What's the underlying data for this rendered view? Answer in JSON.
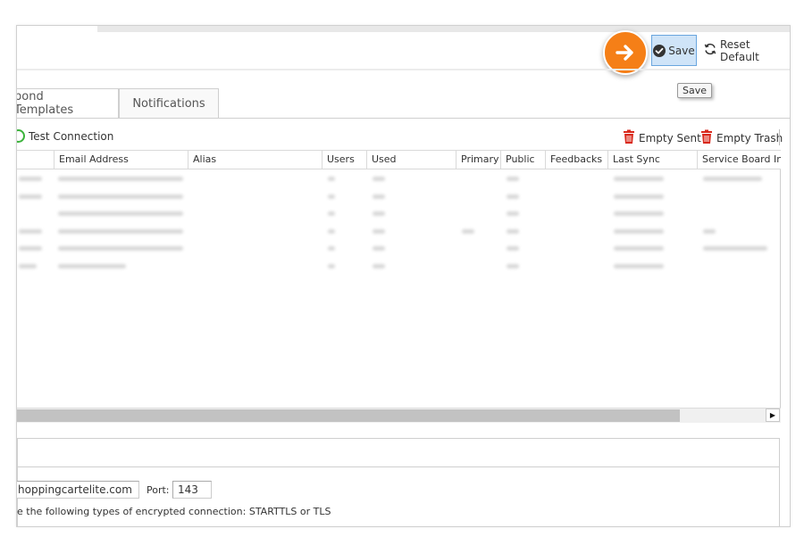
{
  "toolbar": {
    "save_label": "Save",
    "reset_label": "Reset Default",
    "save_tooltip": "Save"
  },
  "tabs": [
    {
      "label": "pond Templates"
    },
    {
      "label": "Notifications"
    }
  ],
  "actions": {
    "test_connection": "Test Connection",
    "empty_sent": "Empty Sent",
    "empty_trash": "Empty Trash"
  },
  "table": {
    "columns": [
      "",
      "Email Address",
      "Alias",
      "Users",
      "Used",
      "Primary",
      "Public",
      "Feedbacks",
      "Last Sync",
      "Service Board In"
    ]
  },
  "settings": {
    "host_value": "hoppingcartelite.com",
    "port_label": "Port:",
    "port_value": "143",
    "encryption_note": "e the following types of encrypted connection: STARTTLS  or TLS"
  },
  "colors": {
    "callout": "#f57f17",
    "save_button_bg": "#cfe4f8",
    "save_button_border": "#6aa6de",
    "trash_icon": "#d9291c",
    "test_icon": "#3bb33b"
  },
  "icons": {
    "callout": "arrow-right-icon",
    "save": "check-circle-icon",
    "reset": "refresh-icon",
    "test": "circle-icon",
    "trash": "trash-icon",
    "scroll_right": "triangle-right-icon"
  }
}
